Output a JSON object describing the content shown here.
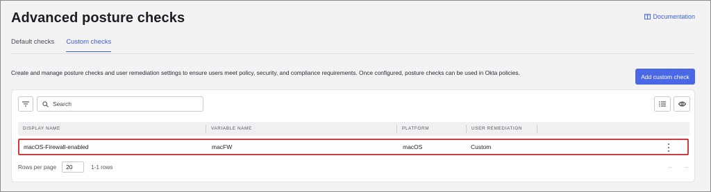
{
  "page": {
    "title": "Advanced posture checks",
    "documentation_label": "Documentation"
  },
  "tabs": [
    {
      "label": "Default checks",
      "active": false
    },
    {
      "label": "Custom checks",
      "active": true
    }
  ],
  "intro_text": "Create and manage posture checks and user remediation settings to ensure users meet policy, security, and compliance requirements. Once configured, posture checks can be used in Okta policies.",
  "add_button_label": "Add custom check",
  "toolbar": {
    "filter_icon": "filter-icon",
    "search_placeholder": "Search",
    "list_icon": "list-icon",
    "eye_icon": "eye-icon"
  },
  "table": {
    "columns": [
      "DISPLAY NAME",
      "VARIABLE NAME",
      "PLATFORM",
      "USER REMEDIATION"
    ],
    "rows": [
      {
        "display_name": "macOS-Firewall-enabled",
        "variable_name": "macFW",
        "platform": "macOS",
        "user_remediation": "Custom"
      }
    ]
  },
  "footer": {
    "rows_per_page_label": "Rows per page",
    "rows_per_page_value": "20",
    "rows_count": "1-1 rows",
    "prev_arrow": "←",
    "next_arrow": "→"
  },
  "colors": {
    "accent": "#4a67e6",
    "link": "#3b5bdb",
    "highlight_border": "#cf3a3a"
  }
}
